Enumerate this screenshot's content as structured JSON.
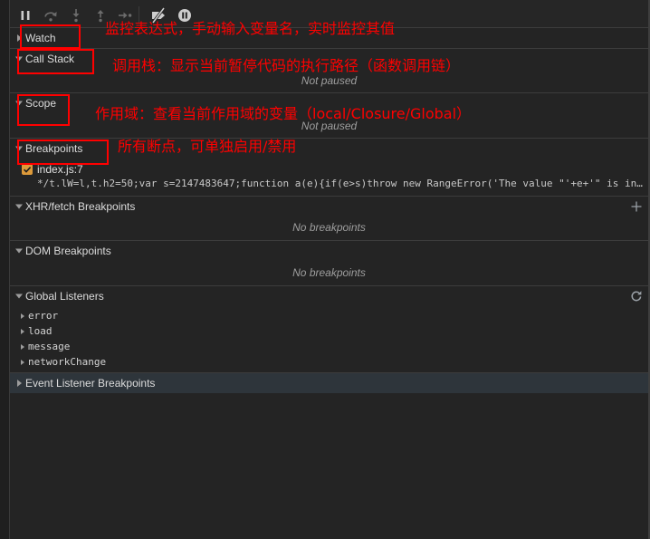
{
  "toolbar": {
    "icons": [
      "pause-icon",
      "step-over-icon",
      "step-into-icon",
      "step-out-icon",
      "step-icon",
      "deactivate-breakpoints-icon",
      "pause-on-exceptions-icon"
    ]
  },
  "sections": {
    "watch": {
      "title": "Watch",
      "expanded": false
    },
    "call_stack": {
      "title": "Call Stack",
      "expanded": true,
      "status": "Not paused"
    },
    "scope": {
      "title": "Scope",
      "expanded": true,
      "status": "Not paused"
    },
    "breakpoints": {
      "title": "Breakpoints",
      "expanded": true,
      "items": [
        {
          "location": "index.js:7",
          "enabled": true,
          "code": "*/t.lW=l,t.h2=50;var s=2147483647;function a(e){if(e>s)throw new RangeError('The value \"'+e+'\" is in…"
        }
      ]
    },
    "xhr_fetch_breakpoints": {
      "title": "XHR/fetch Breakpoints",
      "expanded": true,
      "status": "No breakpoints",
      "action_icon": "add-icon"
    },
    "dom_breakpoints": {
      "title": "DOM Breakpoints",
      "expanded": true,
      "status": "No breakpoints"
    },
    "global_listeners": {
      "title": "Global Listeners",
      "expanded": true,
      "action_icon": "refresh-icon",
      "items": [
        "error",
        "load",
        "message",
        "networkChange"
      ]
    },
    "event_listener_breakpoints": {
      "title": "Event Listener Breakpoints",
      "expanded": false
    }
  },
  "annotations": {
    "watch": "监控表达式，手动输入变量名，实时监控其值",
    "call_stack": "调用栈：显示当前暂停代码的执行路径（函数调用链）",
    "scope": "作用域：查看当前作用域的变量（local/Closure/Global）",
    "breakpoints": "所有断点，可单独启用/禁用"
  },
  "colors": {
    "background": "#242424",
    "annotation": "#ff0000",
    "checkbox": "#dd9a3a",
    "highlight_row": "#2e353b"
  }
}
